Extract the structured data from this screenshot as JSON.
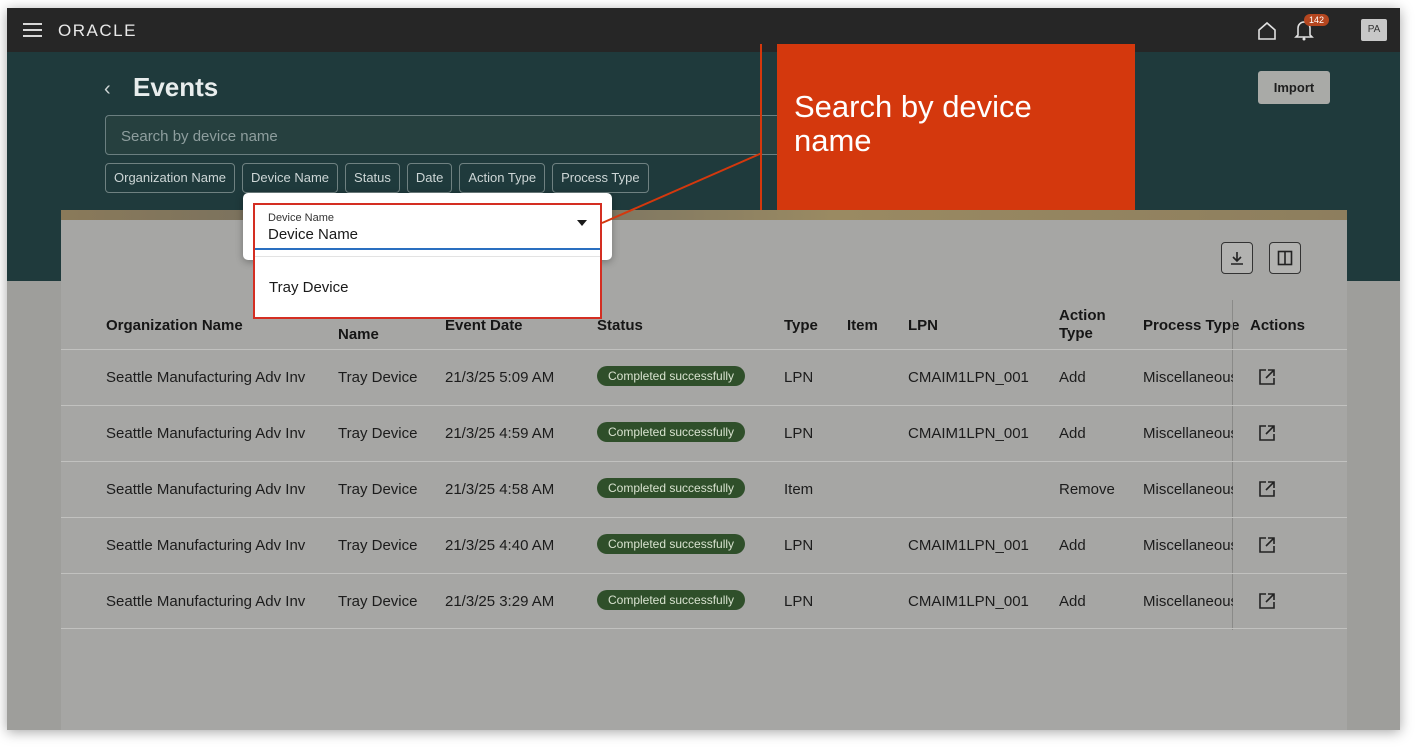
{
  "topbar": {
    "logo": "ORACLE",
    "notification_count": "142",
    "avatar_initials": "PA"
  },
  "header": {
    "title": "Events",
    "search_placeholder": "Search by device name",
    "filters": [
      "Organization Name",
      "Device Name",
      "Status",
      "Date",
      "Action Type",
      "Process Type"
    ],
    "import_label": "Import"
  },
  "dropdown": {
    "label": "Device Name",
    "value": "Device Name",
    "options": [
      "Tray Device"
    ]
  },
  "callout": {
    "text": "Search by device name",
    "color": "#d4380d"
  },
  "table": {
    "headers": {
      "org": "Organization Name",
      "device": "Name",
      "date": "Event Date",
      "status": "Status",
      "type": "Type",
      "item": "Item",
      "lpn": "LPN",
      "action_type": "Action Type",
      "process_type": "Process Type",
      "actions": "Actions"
    },
    "rows": [
      {
        "org": "Seattle Manufacturing Adv Inv",
        "device": "Tray Device",
        "date": "21/3/25 5:09 AM",
        "status": "Completed successfully",
        "type": "LPN",
        "item": "",
        "lpn": "CMAIM1LPN_001",
        "action": "Add",
        "process": "Miscellaneous"
      },
      {
        "org": "Seattle Manufacturing Adv Inv",
        "device": "Tray Device",
        "date": "21/3/25 4:59 AM",
        "status": "Completed successfully",
        "type": "LPN",
        "item": "",
        "lpn": "CMAIM1LPN_001",
        "action": "Add",
        "process": "Miscellaneous"
      },
      {
        "org": "Seattle Manufacturing Adv Inv",
        "device": "Tray Device",
        "date": "21/3/25 4:58 AM",
        "status": "Completed successfully",
        "type": "Item",
        "item": "",
        "lpn": "",
        "action": "Remove",
        "process": "Miscellaneous"
      },
      {
        "org": "Seattle Manufacturing Adv Inv",
        "device": "Tray Device",
        "date": "21/3/25 4:40 AM",
        "status": "Completed successfully",
        "type": "LPN",
        "item": "",
        "lpn": "CMAIM1LPN_001",
        "action": "Add",
        "process": "Miscellaneous"
      },
      {
        "org": "Seattle Manufacturing Adv Inv",
        "device": "Tray Device",
        "date": "21/3/25 3:29 AM",
        "status": "Completed successfully",
        "type": "LPN",
        "item": "",
        "lpn": "CMAIM1LPN_001",
        "action": "Add",
        "process": "Miscellaneous"
      }
    ]
  }
}
